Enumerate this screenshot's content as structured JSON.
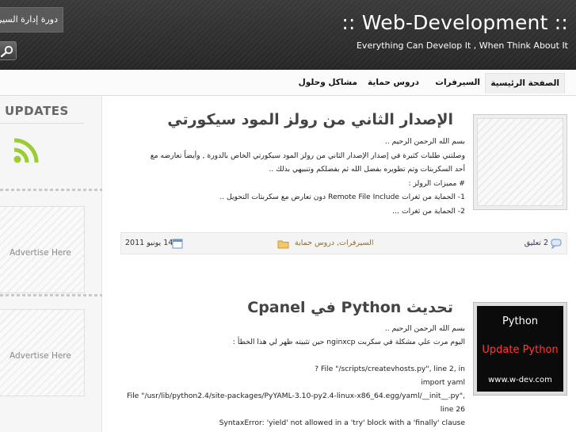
{
  "header": {
    "title": ":: Web-Development ::",
    "description": "Everything Can Develop It , When Think About It",
    "top_box_text": "دورة إدارة السيرفرات"
  },
  "nav": {
    "items": [
      {
        "label": "الصفحة الرئيسية",
        "active": true
      },
      {
        "label": "السيرفرات",
        "active": false
      },
      {
        "label": "دروس حماية",
        "active": false
      },
      {
        "label": "مشاكل وحلول",
        "active": false
      }
    ]
  },
  "sidebar": {
    "updates_title": "UPDATES",
    "ads": [
      "Advertise Here",
      "Advertise Here"
    ]
  },
  "posts": [
    {
      "title": "الإصدار الثاني من رولز المود سيكورتي",
      "lines": [
        "بسم الله الرحمن الرحيم ..",
        "وصلتني طلبات كثيرة في إصدار الإصدار الثاني من رولز المود سيكورتي الخاص بالدورة , وأيضاً تعارضه مع",
        "أحد السكربتات وتم تطويره بفضل الله ثم بفضلكم وتنبيهي بذلك ..",
        "# مميزات الرولز :",
        "1- الحماية من ثغرات Remote File Include دون تعارض مع سكربتات التحويل ..",
        "2- الحماية من ثغرات …"
      ],
      "comments": "2 تعليق",
      "categories": "السيرفرات, دروس حماية",
      "date": "14 يونيو 2011"
    },
    {
      "title": "تحديث Python في Cpanel",
      "lines": [
        "بسم الله الرحمن الرحيم ..",
        "اليوم مرت علي مشكلة في سكربت nginxcp حين تثبيته ظهر لي هذا الخطأ :",
        "",
        "? File \"/scripts/createvhosts.py\", line 2, in",
        "import yaml",
        "File \"/usr/lib/python2.4/site-packages/PyYAML-3.10-py2.4-linux-x86_64.egg/yaml/__init__.py\",",
        "line 26",
        "SyntaxError: 'yield' not allowed in a 'try' block with a 'finally' clause"
      ],
      "thumb": {
        "line1": "Python",
        "line2": "Update Python",
        "line3": "www.w-dev.com"
      }
    }
  ],
  "colors": {
    "header_bg": "#2e2e2e",
    "rss": "#9acd32",
    "python_red": "#ff3b3b"
  }
}
